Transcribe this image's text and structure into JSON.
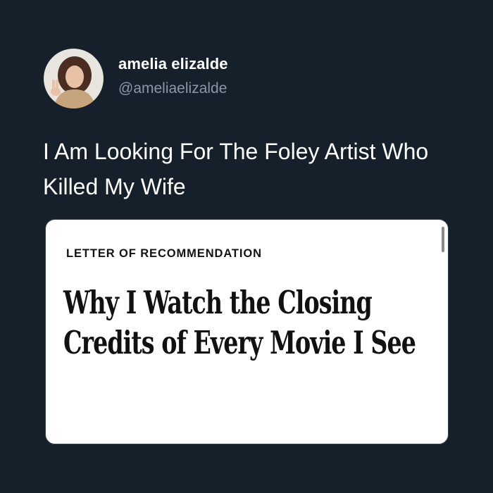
{
  "tweet": {
    "display_name": "amelia elizalde",
    "handle": "@ameliaelizalde",
    "text": "I Am Looking For The Foley Artist Who Killed My Wife"
  },
  "article_card": {
    "kicker": "LETTER OF RECOMMENDATION",
    "headline": "Why I Watch the Closing Credits of Every Movie I See"
  },
  "colors": {
    "background": "#15202b",
    "handle_gray": "#8b98a5",
    "card_background": "#ffffff"
  }
}
